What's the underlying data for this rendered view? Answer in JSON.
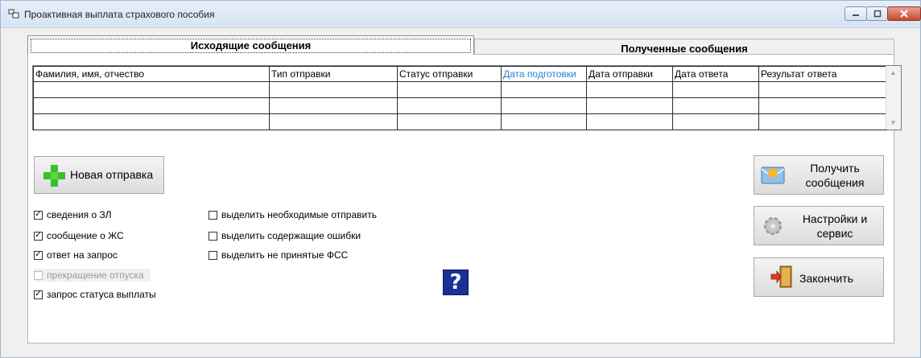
{
  "window": {
    "title": "Проактивная выплата страхового пособия"
  },
  "tabs": [
    {
      "label": "Исходящие сообщения",
      "active": true
    },
    {
      "label": "Полученные сообщения",
      "active": false
    }
  ],
  "grid": {
    "columns": [
      "Фамилия, имя, отчество",
      "Тип отправки",
      "Статус отправки",
      "Дата подготовки",
      "Дата отправки",
      "Дата ответа",
      "Результат ответа"
    ],
    "highlight_column": "Дата подготовки",
    "highlight_color": "#2a7fd9",
    "rows": [
      [
        "",
        "",
        "",
        "",
        "",
        "",
        ""
      ],
      [
        "",
        "",
        "",
        "",
        "",
        "",
        ""
      ],
      [
        "",
        "",
        "",
        "",
        "",
        "",
        ""
      ]
    ]
  },
  "buttons": {
    "new_send": "Новая отправка",
    "get_messages": "Получить сообщения",
    "settings": "Настройки и сервис",
    "exit": "Закончить",
    "help": "?"
  },
  "checkboxes_left": [
    {
      "label": "сведения о ЗЛ",
      "checked": true,
      "enabled": true
    },
    {
      "label": "сообщение о ЖС",
      "checked": true,
      "enabled": true
    },
    {
      "label": "ответ на запрос",
      "checked": true,
      "enabled": true
    },
    {
      "label": "прекращение отпуска",
      "checked": false,
      "enabled": false
    },
    {
      "label": "запрос статуса выплаты",
      "checked": true,
      "enabled": true
    }
  ],
  "checkboxes_middle": [
    {
      "label": "выделить необходимые отправить",
      "checked": false
    },
    {
      "label": "выделить содержащие ошибки",
      "checked": false
    },
    {
      "label": "выделить не принятые ФСС",
      "checked": false
    }
  ],
  "icons": [
    "app-icon",
    "minimize-icon",
    "maximize-icon",
    "close-icon",
    "plus-icon",
    "envelope-icon",
    "gear-icon",
    "exit-door-icon",
    "help-icon"
  ]
}
